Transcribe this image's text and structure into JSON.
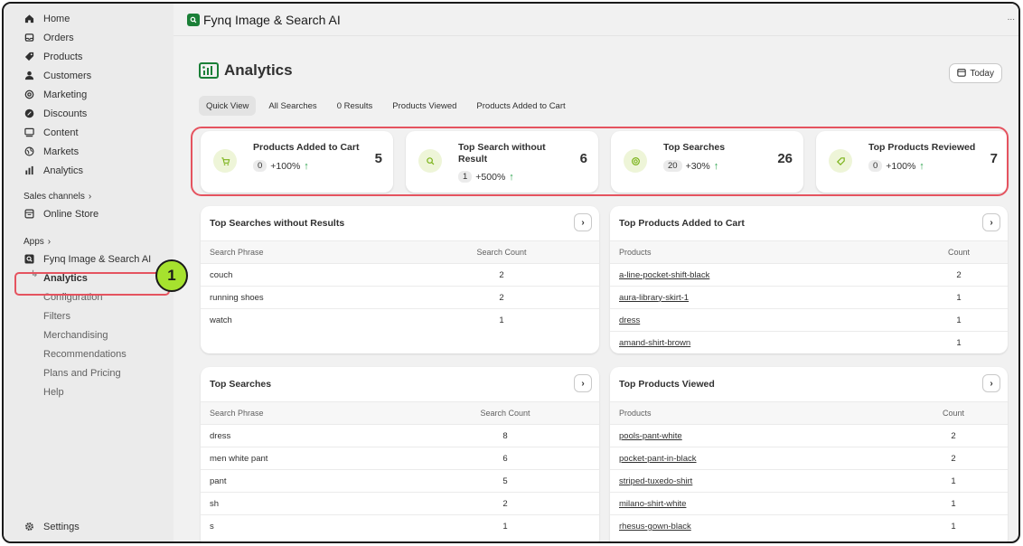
{
  "sidebar": {
    "items": [
      {
        "label": "Home",
        "icon": "home-icon"
      },
      {
        "label": "Orders",
        "icon": "orders-icon"
      },
      {
        "label": "Products",
        "icon": "tag-icon"
      },
      {
        "label": "Customers",
        "icon": "person-icon"
      },
      {
        "label": "Marketing",
        "icon": "target-icon"
      },
      {
        "label": "Discounts",
        "icon": "discount-icon"
      },
      {
        "label": "Content",
        "icon": "content-icon"
      },
      {
        "label": "Markets",
        "icon": "globe-icon"
      },
      {
        "label": "Analytics",
        "icon": "bar-chart-icon"
      }
    ],
    "sales_channels_label": "Sales channels",
    "online_store_label": "Online Store",
    "apps_label": "Apps",
    "app_name": "Fynq Image & Search AI",
    "app_subitems": [
      "Analytics",
      "Configuration",
      "Filters",
      "Merchandising",
      "Recommendations",
      "Plans and Pricing",
      "Help"
    ],
    "settings_label": "Settings",
    "step_badge": "1"
  },
  "topbar": {
    "title": "Fynq Image & Search AI",
    "more": "..."
  },
  "page": {
    "title": "Analytics",
    "today_label": "Today"
  },
  "tabs": [
    "Quick View",
    "All Searches",
    "0 Results",
    "Products Viewed",
    "Products Added to Cart"
  ],
  "stats": [
    {
      "title": "Products Added to Cart",
      "value": "5",
      "pill": "0",
      "change": "+100%"
    },
    {
      "title": "Top Search without Result",
      "value": "6",
      "pill": "1",
      "change": "+500%"
    },
    {
      "title": "Top Searches",
      "value": "26",
      "pill": "20",
      "change": "+30%"
    },
    {
      "title": "Top Products Reviewed",
      "value": "7",
      "pill": "0",
      "change": "+100%"
    }
  ],
  "tables": {
    "no_results": {
      "title": "Top Searches without Results",
      "col1": "Search Phrase",
      "col2": "Search Count",
      "rows": [
        [
          "couch",
          "2"
        ],
        [
          "running shoes",
          "2"
        ],
        [
          "watch",
          "1"
        ]
      ]
    },
    "added_to_cart": {
      "title": "Top Products Added to Cart",
      "col1": "Products",
      "col2": "Count",
      "rows": [
        [
          "a-line-pocket-shift-black",
          "2"
        ],
        [
          "aura-library-skirt-1",
          "1"
        ],
        [
          "dress",
          "1"
        ],
        [
          "amand-shirt-brown",
          "1"
        ]
      ]
    },
    "top_searches": {
      "title": "Top Searches",
      "col1": "Search Phrase",
      "col2": "Search Count",
      "rows": [
        [
          "dress",
          "8"
        ],
        [
          "men white pant",
          "6"
        ],
        [
          "pant",
          "5"
        ],
        [
          "sh",
          "2"
        ],
        [
          "s",
          "1"
        ]
      ]
    },
    "viewed": {
      "title": "Top Products Viewed",
      "col1": "Products",
      "col2": "Count",
      "rows": [
        [
          "pools-pant-white",
          "2"
        ],
        [
          "pocket-pant-in-black",
          "2"
        ],
        [
          "striped-tuxedo-shirt",
          "1"
        ],
        [
          "milano-shirt-white",
          "1"
        ],
        [
          "rhesus-gown-black",
          "1"
        ]
      ]
    }
  },
  "colors": {
    "accent": "#e5535f",
    "brand": "#1a7f37",
    "up": "#2ba24c",
    "badge": "#a6e22e"
  }
}
